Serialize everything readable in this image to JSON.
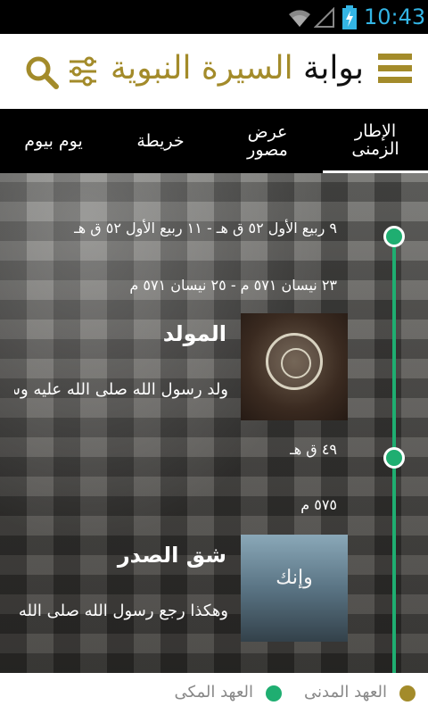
{
  "status_bar": {
    "time": "10:43",
    "icons": [
      "wifi-icon",
      "signal-icon",
      "battery-charging-icon"
    ],
    "time_color": "#33b5e5"
  },
  "header": {
    "title_part1": "بوابة ",
    "title_part2": "السيرة النبوية",
    "accent_color": "#a38b2a",
    "icons": [
      "menu-icon",
      "filter-icon",
      "search-icon"
    ]
  },
  "tabs": [
    {
      "line1": "الإطار",
      "line2": "الزمنى",
      "active": true
    },
    {
      "line1": "عرض",
      "line2": "مصور",
      "active": false
    },
    {
      "line1": "خريطة",
      "line2": "",
      "active": false
    },
    {
      "line1": "يوم بيوم",
      "line2": "",
      "active": false
    }
  ],
  "timeline": {
    "line_color": "#1fae71",
    "events": [
      {
        "hijri_date": "٩ ربيع الأول ٥٢ ق هـ - ١١ ربيع الأول ٥٢ ق هـ",
        "gregorian_date": "٢٣ نيسان ٥٧١ م - ٢٥ نيسان ٥٧١ م",
        "title": "المولد",
        "text": "ولد رسول الله صلى الله عليه وسلم بشعب",
        "thumbnail": "calligraphy-medallion-image"
      },
      {
        "hijri_date": "٤٩ ق هـ",
        "gregorian_date": "٥٧٥ م",
        "title": "شق الصدر",
        "text": "وهكذا رجع رسول الله صلى الله عليه وسلم",
        "thumbnail": "calligraphy-sky-image",
        "thumbnail_text": "وإنك"
      }
    ]
  },
  "legend": {
    "items": [
      {
        "label": "العهد المدنى",
        "color": "#a38b2a"
      },
      {
        "label": "العهد المكى",
        "color": "#1fae71"
      }
    ]
  }
}
